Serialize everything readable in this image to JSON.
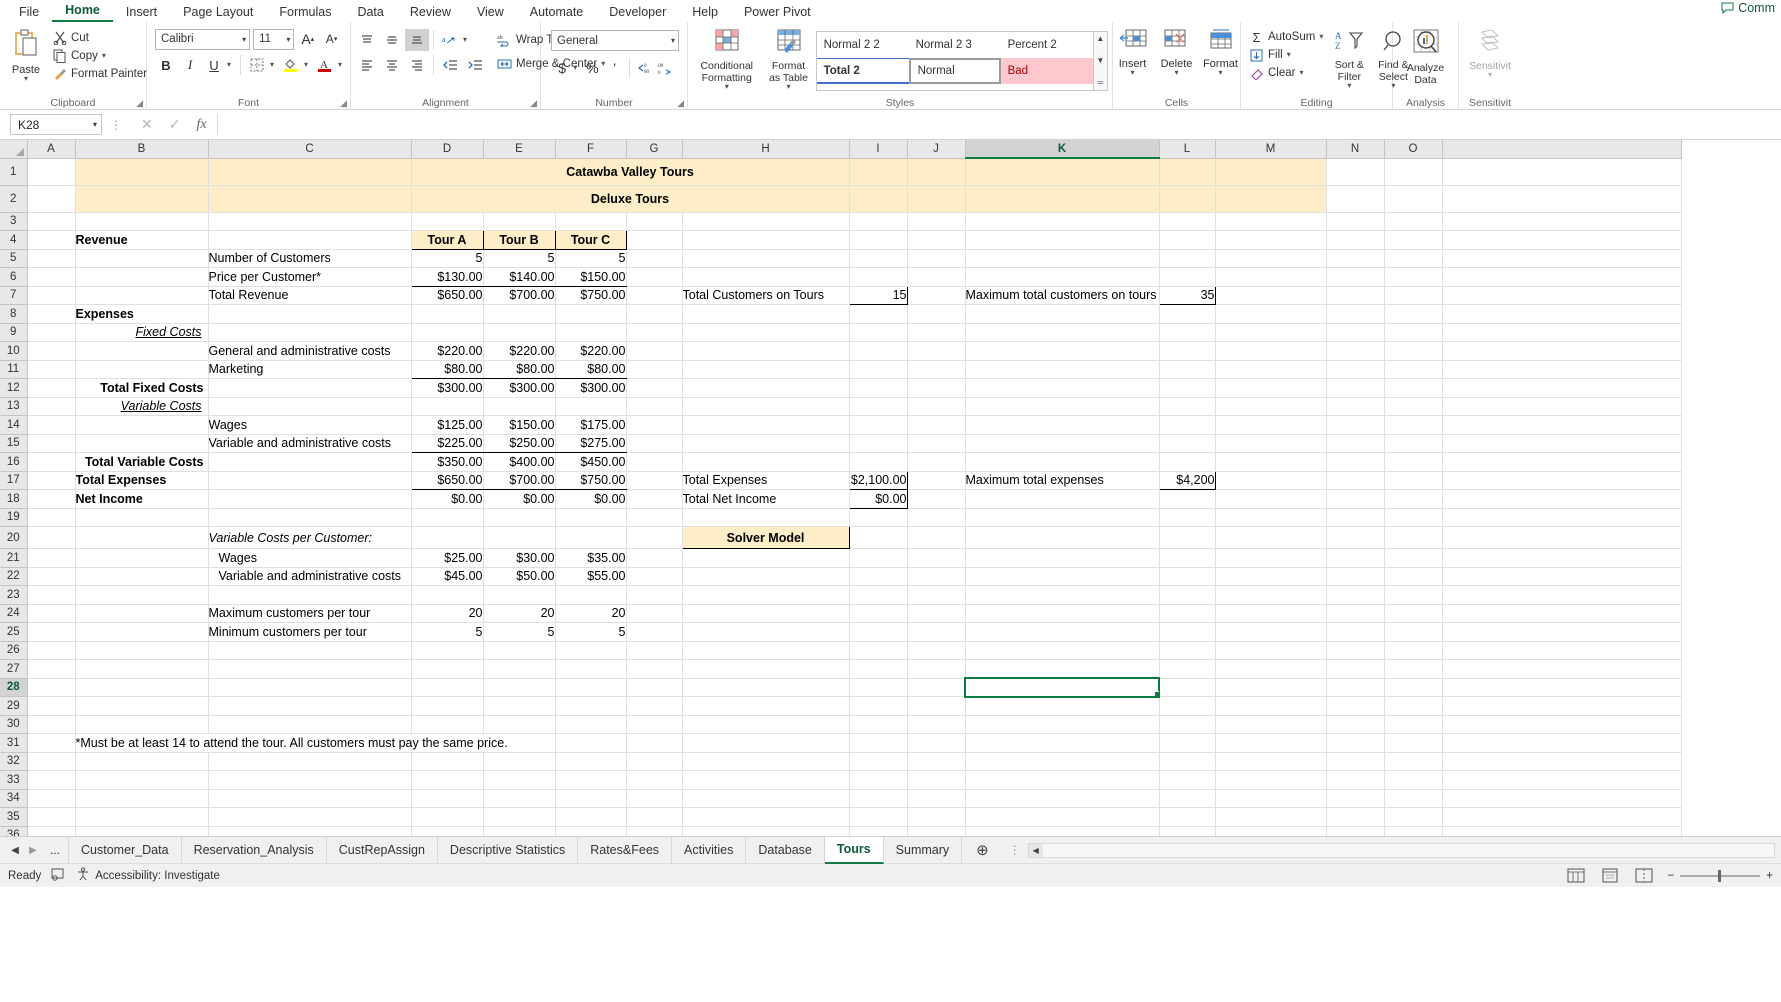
{
  "ribbon": {
    "tabs": [
      "File",
      "Home",
      "Insert",
      "Page Layout",
      "Formulas",
      "Data",
      "Review",
      "View",
      "Automate",
      "Developer",
      "Help",
      "Power Pivot"
    ],
    "active_tab": "Home",
    "comments_label": "Comm",
    "groups": {
      "clipboard": {
        "label": "Clipboard",
        "paste": "Paste",
        "cut": "Cut",
        "copy": "Copy",
        "format_painter": "Format Painter"
      },
      "font": {
        "label": "Font",
        "font_name": "Calibri",
        "font_size": "11"
      },
      "alignment": {
        "label": "Alignment",
        "wrap_text": "Wrap Text",
        "merge_center": "Merge & Center"
      },
      "number": {
        "label": "Number",
        "format": "General"
      },
      "styles": {
        "label": "Styles",
        "conditional_formatting": "Conditional Formatting",
        "format_as_table": "Format as Table",
        "gallery": [
          "Normal 2 2",
          "Normal 2 3",
          "Percent 2",
          "Total 2",
          "Normal",
          "Bad"
        ],
        "selected": "Normal"
      },
      "cells": {
        "label": "Cells",
        "insert": "Insert",
        "delete": "Delete",
        "format": "Format"
      },
      "editing": {
        "label": "Editing",
        "autosum": "AutoSum",
        "fill": "Fill",
        "clear": "Clear",
        "sort_filter": "Sort & Filter",
        "find_select": "Find & Select"
      },
      "analysis": {
        "label": "Analysis",
        "analyze_data": "Analyze Data"
      },
      "sensitivity": {
        "label": "Sensitivit",
        "button": "Sensitivit"
      }
    }
  },
  "formula_bar": {
    "name_box": "K28",
    "formula": "",
    "cancel_icon": "cancel-icon",
    "enter_icon": "enter-icon",
    "fx_icon": "fx-icon"
  },
  "grid": {
    "columns": [
      "A",
      "B",
      "C",
      "D",
      "E",
      "F",
      "G",
      "H",
      "I",
      "J",
      "K",
      "L",
      "M",
      "N",
      "O"
    ],
    "selected_column": "K",
    "selected_row": "28",
    "selected_cell": "K28",
    "rows": [
      "1",
      "2",
      "3",
      "4",
      "5",
      "6",
      "7",
      "8",
      "9",
      "10",
      "11",
      "12",
      "13",
      "14",
      "15",
      "16",
      "17",
      "18",
      "19",
      "20",
      "21",
      "22",
      "23",
      "24",
      "25",
      "26",
      "27",
      "28",
      "29",
      "30",
      "31",
      "32",
      "33",
      "34",
      "35",
      "36"
    ],
    "title_main": "Catawba Valley Tours",
    "title_sub": "Deluxe Tours",
    "tour_headers": [
      "Tour A",
      "Tour B",
      "Tour C"
    ],
    "labels": {
      "revenue": "Revenue",
      "number_of_customers": "Number of Customers",
      "price_per_customer": "Price per Customer*",
      "total_revenue": "Total Revenue",
      "expenses": "Expenses",
      "fixed_costs": "Fixed Costs",
      "general_admin": "General and administrative costs",
      "marketing": "Marketing",
      "total_fixed_costs": "Total Fixed Costs",
      "variable_costs": "Variable Costs",
      "wages": "Wages",
      "variable_admin": "Variable and administrative costs",
      "total_variable_costs": "Total Variable Costs",
      "total_expenses": "Total Expenses",
      "net_income": "Net Income",
      "variable_costs_per_customer": "Variable Costs per Customer:",
      "wages_pc": "Wages",
      "variable_admin_pc": "Variable and administrative costs",
      "max_customers_per_tour": "Maximum customers per tour",
      "min_customers_per_tour": "Minimum customers per tour",
      "footnote": "*Must be at least 14 to attend the tour. All customers must pay the same price."
    },
    "values": {
      "number_of_customers": [
        "5",
        "5",
        "5"
      ],
      "price_per_customer": [
        "$130.00",
        "$140.00",
        "$150.00"
      ],
      "total_revenue": [
        "$650.00",
        "$700.00",
        "$750.00"
      ],
      "general_admin": [
        "$220.00",
        "$220.00",
        "$220.00"
      ],
      "marketing": [
        "$80.00",
        "$80.00",
        "$80.00"
      ],
      "total_fixed_costs": [
        "$300.00",
        "$300.00",
        "$300.00"
      ],
      "wages": [
        "$125.00",
        "$150.00",
        "$175.00"
      ],
      "variable_admin": [
        "$225.00",
        "$250.00",
        "$275.00"
      ],
      "total_variable_costs": [
        "$350.00",
        "$400.00",
        "$450.00"
      ],
      "total_expenses": [
        "$650.00",
        "$700.00",
        "$750.00"
      ],
      "net_income": [
        "$0.00",
        "$0.00",
        "$0.00"
      ],
      "wages_pc": [
        "$25.00",
        "$30.00",
        "$35.00"
      ],
      "variable_admin_pc": [
        "$45.00",
        "$50.00",
        "$55.00"
      ],
      "max_customers_per_tour": [
        "20",
        "20",
        "20"
      ],
      "min_customers_per_tour": [
        "5",
        "5",
        "5"
      ]
    },
    "side_panel": {
      "total_customers_label": "Total Customers on Tours",
      "total_customers_value": "15",
      "max_total_customers_label": "Maximum total customers on tours",
      "max_total_customers_value": "35",
      "total_expenses_label": "Total Expenses",
      "total_expenses_value": "$2,100.00",
      "max_total_expenses_label": "Maximum total expenses",
      "max_total_expenses_value": "$4,200",
      "total_net_income_label": "Total Net Income",
      "total_net_income_value": "$0.00",
      "solver_model": "Solver Model"
    }
  },
  "sheet_tabs": {
    "overflow": "...",
    "tabs": [
      "Customer_Data",
      "Reservation_Analysis",
      "CustRepAssign",
      "Descriptive Statistics",
      "Rates&Fees",
      "Activities",
      "Database",
      "Tours",
      "Summary"
    ],
    "active": "Tours",
    "add_label": "+"
  },
  "status_bar": {
    "ready": "Ready",
    "accessibility": "Accessibility: Investigate",
    "zoom": ""
  }
}
